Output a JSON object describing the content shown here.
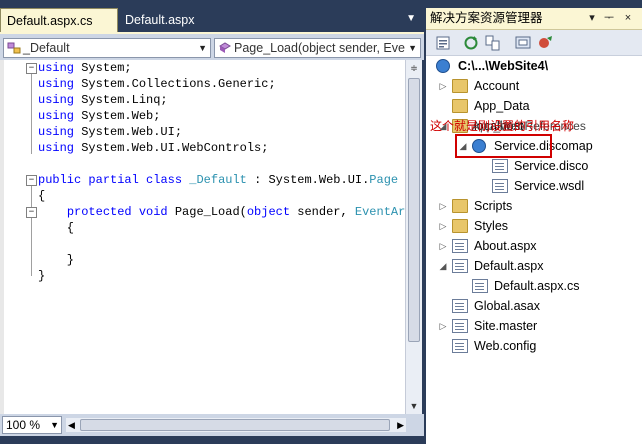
{
  "editor": {
    "tabs": [
      {
        "label": "Default.aspx.cs",
        "active": true
      },
      {
        "label": "Default.aspx",
        "active": false
      }
    ],
    "class_combo": "_Default",
    "member_combo": "Page_Load(object sender, Eve",
    "zoom": "100 %",
    "code_lines": [
      {
        "parts": [
          {
            "t": "using",
            "c": "kw"
          },
          {
            "t": " System;"
          }
        ]
      },
      {
        "parts": [
          {
            "t": "using",
            "c": "kw"
          },
          {
            "t": " System.Collections.Generic;"
          }
        ]
      },
      {
        "parts": [
          {
            "t": "using",
            "c": "kw"
          },
          {
            "t": " System.Linq;"
          }
        ]
      },
      {
        "parts": [
          {
            "t": "using",
            "c": "kw"
          },
          {
            "t": " System.Web;"
          }
        ]
      },
      {
        "parts": [
          {
            "t": "using",
            "c": "kw"
          },
          {
            "t": " System.Web.UI;"
          }
        ]
      },
      {
        "parts": [
          {
            "t": "using",
            "c": "kw"
          },
          {
            "t": " System.Web.UI.WebControls;"
          }
        ]
      },
      {
        "parts": []
      },
      {
        "parts": [
          {
            "t": "public",
            "c": "kw"
          },
          {
            "t": " "
          },
          {
            "t": "partial",
            "c": "kw"
          },
          {
            "t": " "
          },
          {
            "t": "class",
            "c": "kw"
          },
          {
            "t": " "
          },
          {
            "t": "_Default",
            "c": "typ"
          },
          {
            "t": " : System.Web.UI."
          },
          {
            "t": "Page",
            "c": "typ"
          }
        ]
      },
      {
        "parts": [
          {
            "t": "{"
          }
        ]
      },
      {
        "parts": [
          {
            "t": "    "
          },
          {
            "t": "protected",
            "c": "kw"
          },
          {
            "t": " "
          },
          {
            "t": "void",
            "c": "kw"
          },
          {
            "t": " Page_Load("
          },
          {
            "t": "object",
            "c": "kw"
          },
          {
            "t": " sender, "
          },
          {
            "t": "EventArgs",
            "c": "typ"
          }
        ]
      },
      {
        "parts": [
          {
            "t": "    {"
          }
        ]
      },
      {
        "parts": []
      },
      {
        "parts": [
          {
            "t": "    }"
          }
        ]
      },
      {
        "parts": [
          {
            "t": "}"
          }
        ]
      }
    ]
  },
  "solution_explorer": {
    "title": "解决方案资源管理器",
    "header_buttons": [
      "▾",
      "ᅮ",
      "×"
    ],
    "root": "C:\\...\\WebSite4\\",
    "items": [
      {
        "label": "Account",
        "icon": "folder-icon",
        "expander": "▷"
      },
      {
        "label": "App_Data",
        "icon": "folder-icon",
        "expander": ""
      },
      {
        "label": "localhost",
        "icon": "folder-icon",
        "expander": "◢"
      },
      {
        "label": "Service.discomap",
        "icon": "globe-icon",
        "expander": "◢"
      },
      {
        "label": "Service.disco",
        "icon": "page-icon",
        "expander": ""
      },
      {
        "label": "Service.wsdl",
        "icon": "page-icon",
        "expander": ""
      },
      {
        "label": "Scripts",
        "icon": "folder-icon",
        "expander": "▷"
      },
      {
        "label": "Styles",
        "icon": "folder-icon",
        "expander": "▷"
      },
      {
        "label": "About.aspx",
        "icon": "page-icon",
        "expander": "▷"
      },
      {
        "label": "Default.aspx",
        "icon": "page-icon",
        "expander": "◢"
      },
      {
        "label": "Default.aspx.cs",
        "icon": "page-icon",
        "expander": ""
      },
      {
        "label": "Global.asax",
        "icon": "page-icon",
        "expander": ""
      },
      {
        "label": "Site.master",
        "icon": "page-icon",
        "expander": "▷"
      },
      {
        "label": "Web.config",
        "icon": "page-icon",
        "expander": ""
      }
    ],
    "annotation": "这个就是刚设置的引用名称",
    "annotation_behind": "App_WebReferences"
  },
  "colors": {
    "accent_red": "#d00000",
    "keyword": "#0000ff",
    "type": "#2b91af"
  }
}
